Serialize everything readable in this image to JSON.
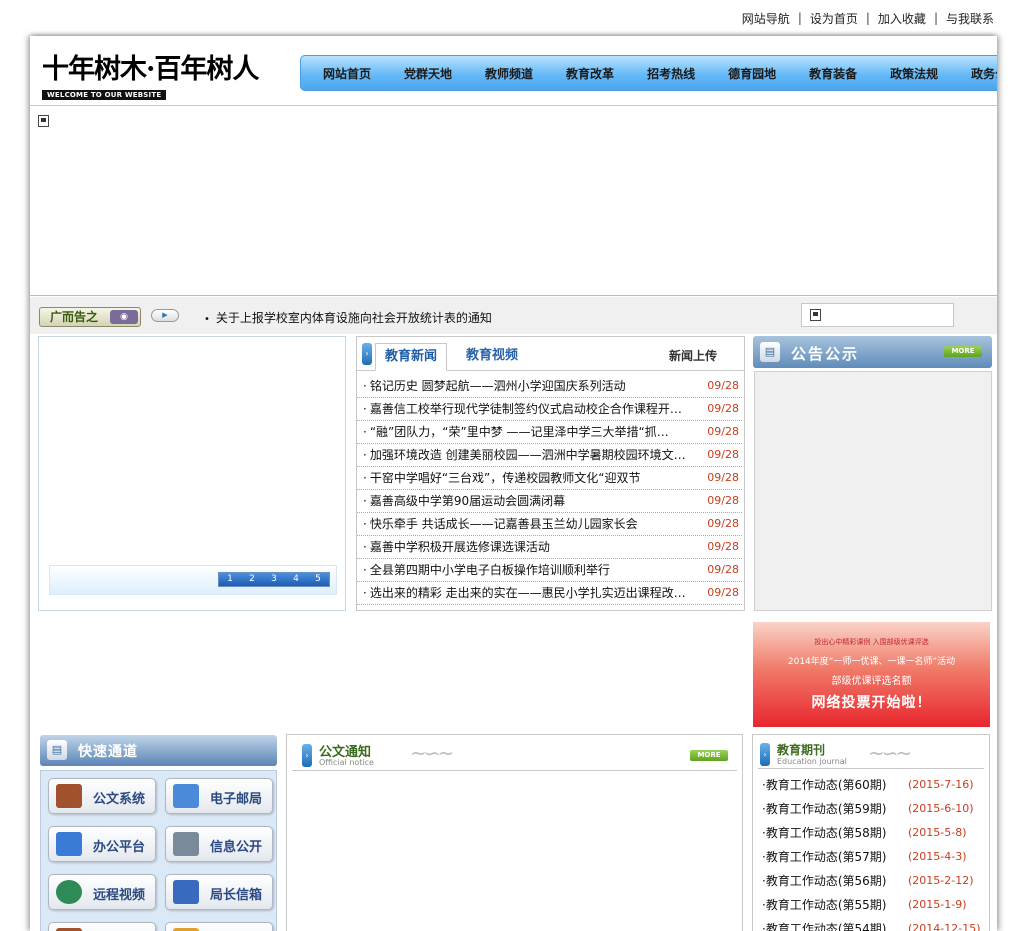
{
  "top_links": [
    "网站导航",
    "设为首页",
    "加入收藏",
    "与我联系"
  ],
  "header": {
    "logo_main": "十年树木·百年树人",
    "logo_sub": "WELCOME TO OUR WEBSITE"
  },
  "nav": [
    "网站首页",
    "党群天地",
    "教师频道",
    "教育改革",
    "招考热线",
    "德育园地",
    "教育装备",
    "政策法规",
    "政务公开"
  ],
  "notice_bar": {
    "ad_label": "广而告之",
    "ticker": "关于上报学校室内体育设施向社会开放统计表的通知"
  },
  "slideshow": {
    "pages": [
      "1",
      "2",
      "3",
      "4",
      "5"
    ]
  },
  "news": {
    "tab_active": "教育新闻",
    "tab_inactive": "教育视频",
    "upload_label": "新闻上传",
    "items": [
      {
        "title": "铭记历史 圆梦起航——泗州小学迎国庆系列活动",
        "date": "09/28"
      },
      {
        "title": "嘉善信工校举行现代学徒制签约仪式启动校企合作课程开发…",
        "date": "09/28"
      },
      {
        "title": "“融”团队力，“荣”里中梦 ——记里泽中学三大举措“抓…",
        "date": "09/28"
      },
      {
        "title": "加强环境改造 创建美丽校园——泗洲中学暑期校园环境文…",
        "date": "09/28"
      },
      {
        "title": "干窑中学唱好“三台戏”，传递校园教师文化“迎双节",
        "date": "09/28"
      },
      {
        "title": "嘉善高级中学第90届运动会圆满闭幕",
        "date": "09/28"
      },
      {
        "title": "快乐牵手 共话成长——记嘉善县玉兰幼儿园家长会",
        "date": "09/28"
      },
      {
        "title": "嘉善中学积极开展选修课选课活动",
        "date": "09/28"
      },
      {
        "title": "全县第四期中小学电子白板操作培训顺利举行",
        "date": "09/28"
      },
      {
        "title": "选出来的精彩 走出来的实在——惠民小学扎实迈出课程改…",
        "date": "09/28"
      }
    ]
  },
  "announcement": {
    "title": "公告公示",
    "more": "MORE"
  },
  "promo": {
    "line1": "投出心中精彩课例  入围部级优课评选",
    "line2": "2014年度“一师一优课、一课一名师”活动",
    "line3": "部级优课评选名额",
    "line4": "网络投票开始啦！"
  },
  "quick": {
    "title": "快速通道",
    "buttons": [
      {
        "label": "公文系统",
        "icon": "briefcase-icon",
        "color": "#a0522d"
      },
      {
        "label": "电子邮局",
        "icon": "mail-icon",
        "color": "#4a8ad8"
      },
      {
        "label": "办公平台",
        "icon": "monitor-icon",
        "color": "#3a7bd5"
      },
      {
        "label": "信息公开",
        "icon": "id-card-icon",
        "color": "#7a8a9a"
      },
      {
        "label": "远程视频",
        "icon": "globe-icon",
        "color": "#2e8b57"
      },
      {
        "label": "局长信箱",
        "icon": "address-book-icon",
        "color": "#3a6ac0"
      }
    ]
  },
  "docs": {
    "title": "公文通知",
    "subtitle": "Official notice",
    "more": "MORE"
  },
  "journal": {
    "title": "教育期刊",
    "subtitle": "Education journal",
    "items": [
      {
        "title": "教育工作动态(第60期)",
        "date": "(2015-7-16)"
      },
      {
        "title": "教育工作动态(第59期)",
        "date": "(2015-6-10)"
      },
      {
        "title": "教育工作动态(第58期)",
        "date": "(2015-5-8)"
      },
      {
        "title": "教育工作动态(第57期)",
        "date": "(2015-4-3)"
      },
      {
        "title": "教育工作动态(第56期)",
        "date": "(2015-2-12)"
      },
      {
        "title": "教育工作动态(第55期)",
        "date": "(2015-1-9)"
      },
      {
        "title": "教育工作动态(第54期)",
        "date": "(2014-12-15)"
      }
    ]
  }
}
